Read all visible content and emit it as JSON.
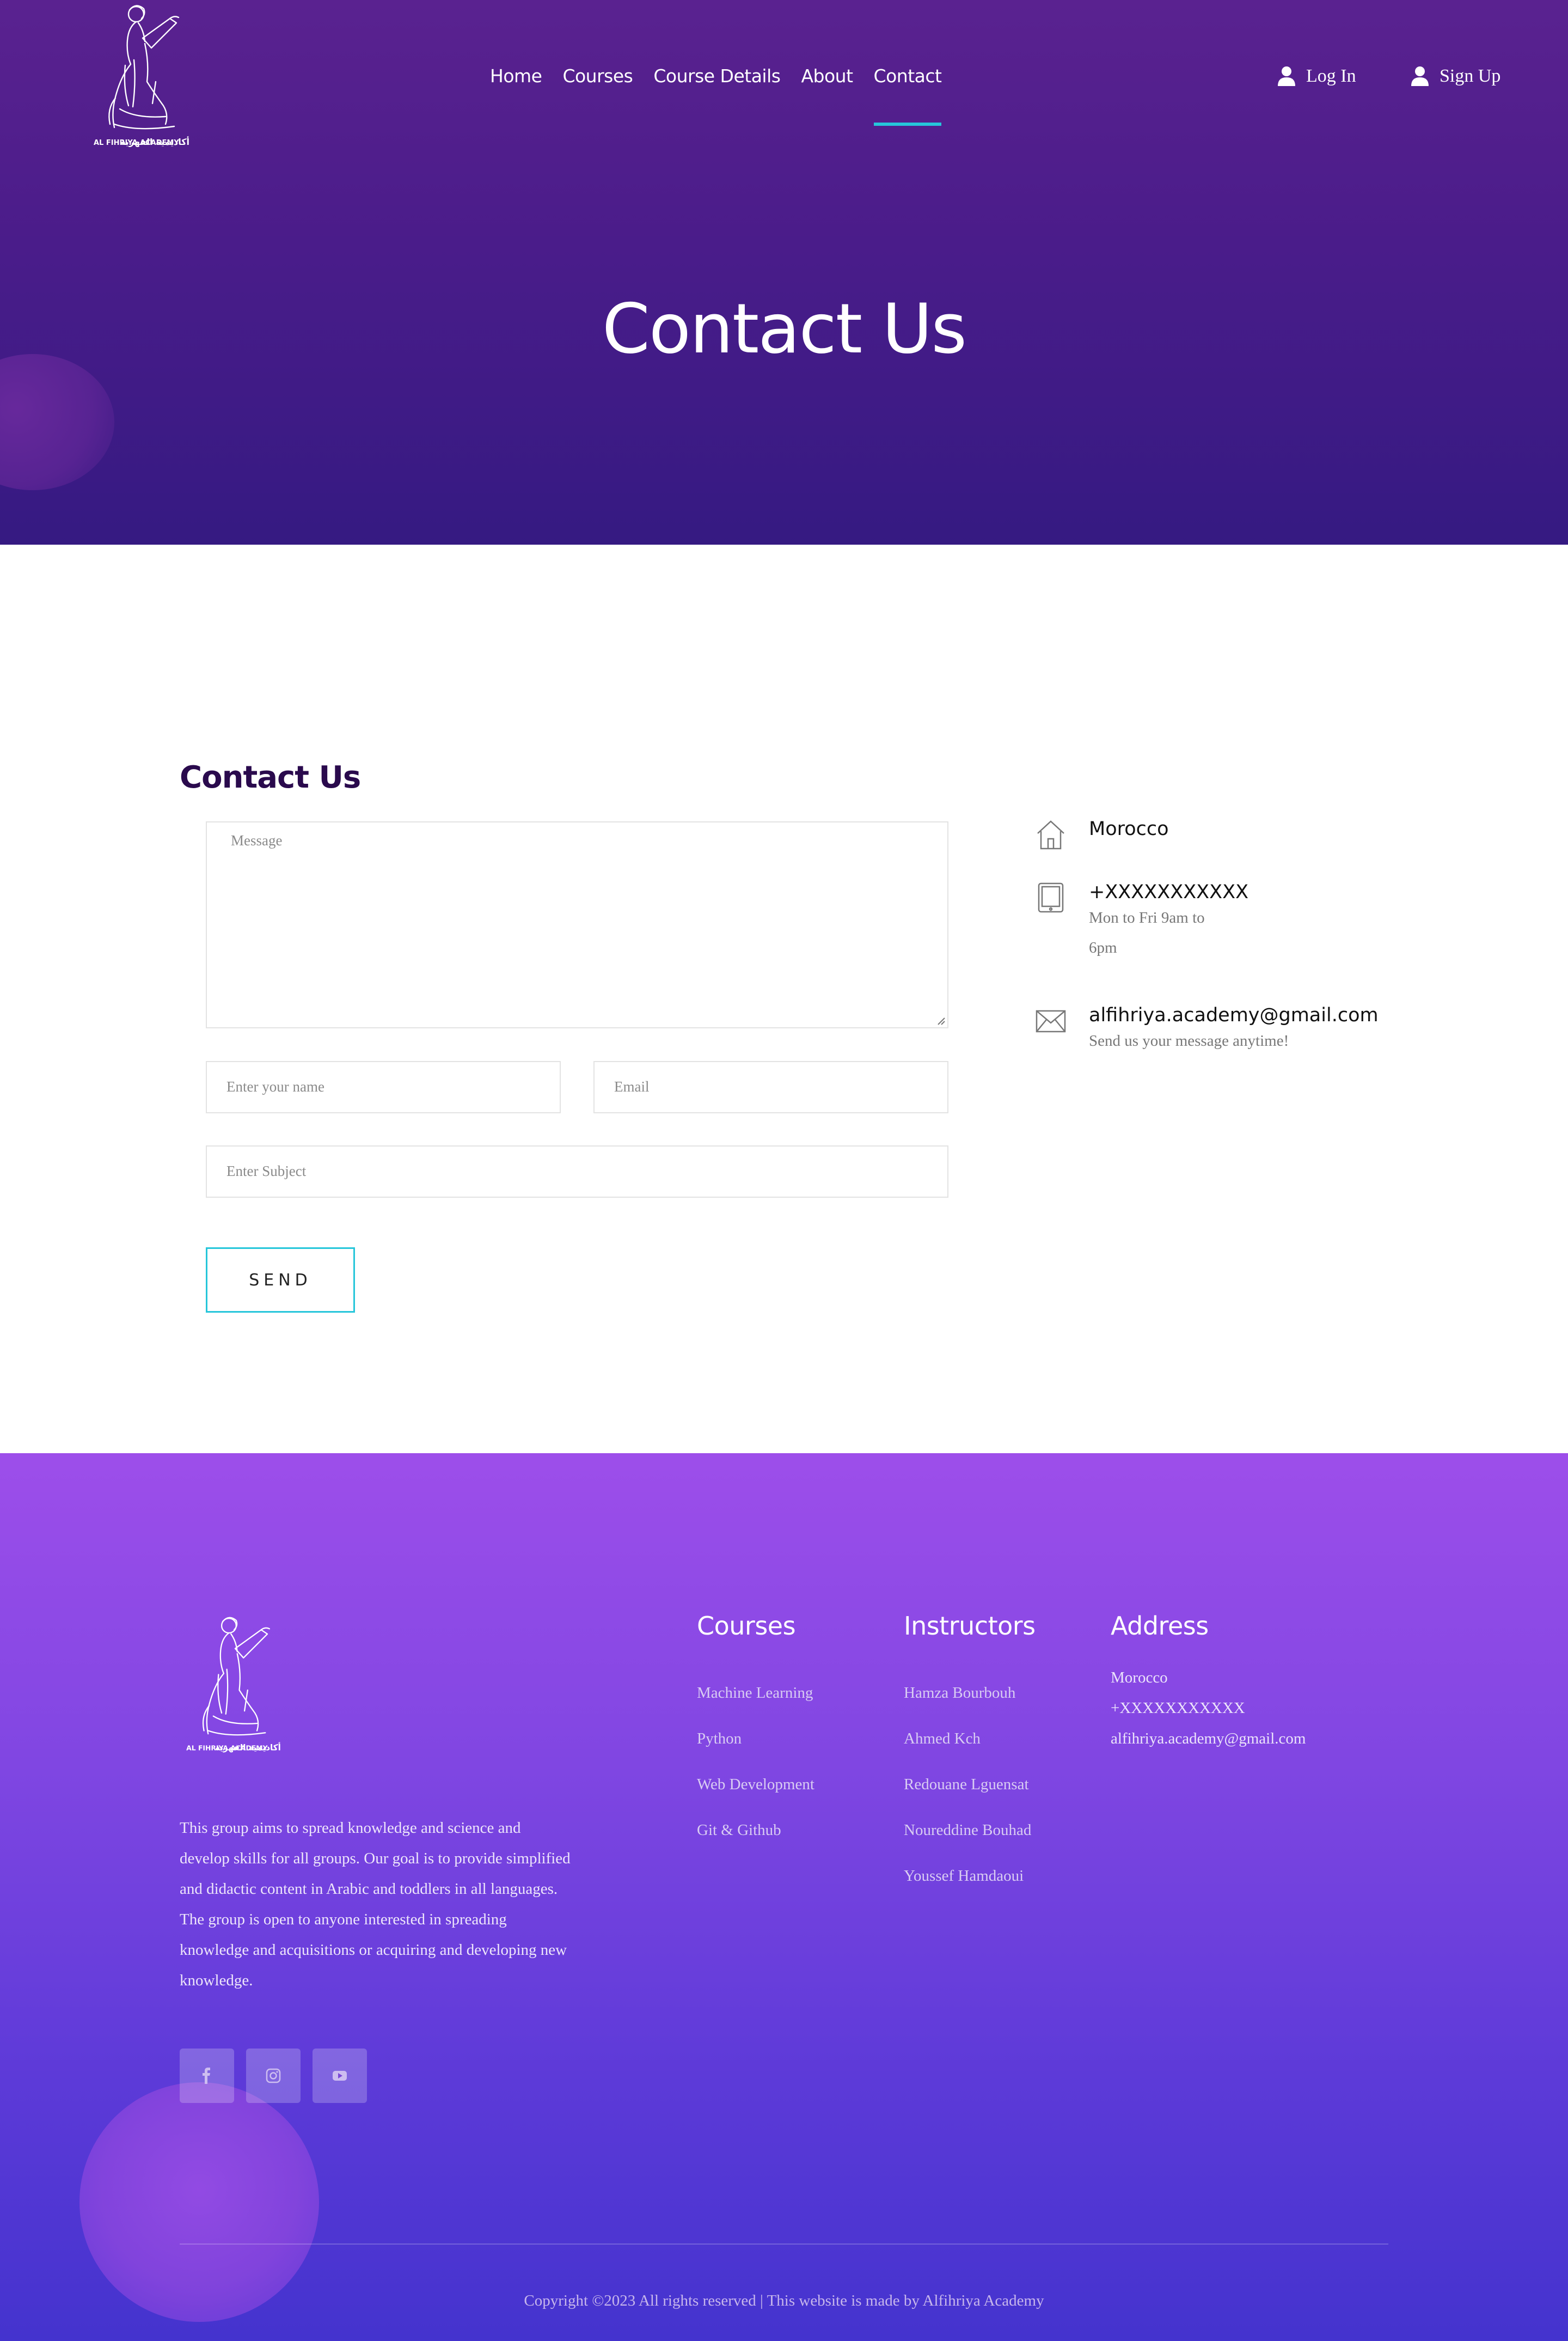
{
  "header": {
    "logo_text_en": "AL FIHRIYA ACADEMY",
    "logo_text_ar": "أكاديمية الفهرية",
    "nav": [
      {
        "label": "Home"
      },
      {
        "label": "Courses"
      },
      {
        "label": "Course Details"
      },
      {
        "label": "About"
      },
      {
        "label": "Contact"
      }
    ],
    "active_nav": "Contact",
    "login_label": "Log In",
    "signup_label": "Sign Up"
  },
  "hero": {
    "title": "Contact Us"
  },
  "contact": {
    "title": "Contact Us",
    "form": {
      "message_placeholder": "Message",
      "name_placeholder": "Enter your name",
      "email_placeholder": "Email",
      "subject_placeholder": "Enter Subject",
      "send_label": "SEND"
    },
    "info": {
      "address": "Morocco",
      "phone": "+XXXXXXXXXXX",
      "phone_hours": "Mon to Fri 9am to 6pm",
      "email": "alfihriya.academy@gmail.com",
      "email_note": "Send us your message anytime!"
    }
  },
  "footer": {
    "logo_text_en": "AL FIHRIYA ACADEMY",
    "logo_text_ar": "أكاديمية الفهرية",
    "about": "This group aims to spread knowledge and science and develop skills for all groups. Our goal is to provide simplified and didactic content in Arabic and toddlers in all languages. The group is open to anyone interested in spreading knowledge and acquisitions or acquiring and developing new knowledge.",
    "socials": [
      "facebook-icon",
      "instagram-icon",
      "youtube-icon"
    ],
    "courses": {
      "title": "Courses",
      "items": [
        "Machine Learning",
        "Python",
        "Web Development",
        "Git & Github"
      ]
    },
    "instructors": {
      "title": "Instructors",
      "items": [
        "Hamza Bourbouh",
        "Ahmed Kch",
        "Redouane Lguensat",
        "Noureddine Bouhad",
        "Youssef Hamdaoui"
      ]
    },
    "address": {
      "title": "Address",
      "items": [
        "Morocco",
        "+XXXXXXXXXXX",
        "alfihriya.academy@gmail.com"
      ]
    },
    "copyright": "Copyright ©2023 All rights reserved | This website is made by Alfihriya Academy"
  },
  "colors": {
    "accent": "#26c6da",
    "hero_top": "#5a2290",
    "hero_bottom": "#351a82",
    "footer_top": "#9d4eea",
    "footer_bottom": "#4433ce",
    "title_dark": "#2a0a4d"
  }
}
